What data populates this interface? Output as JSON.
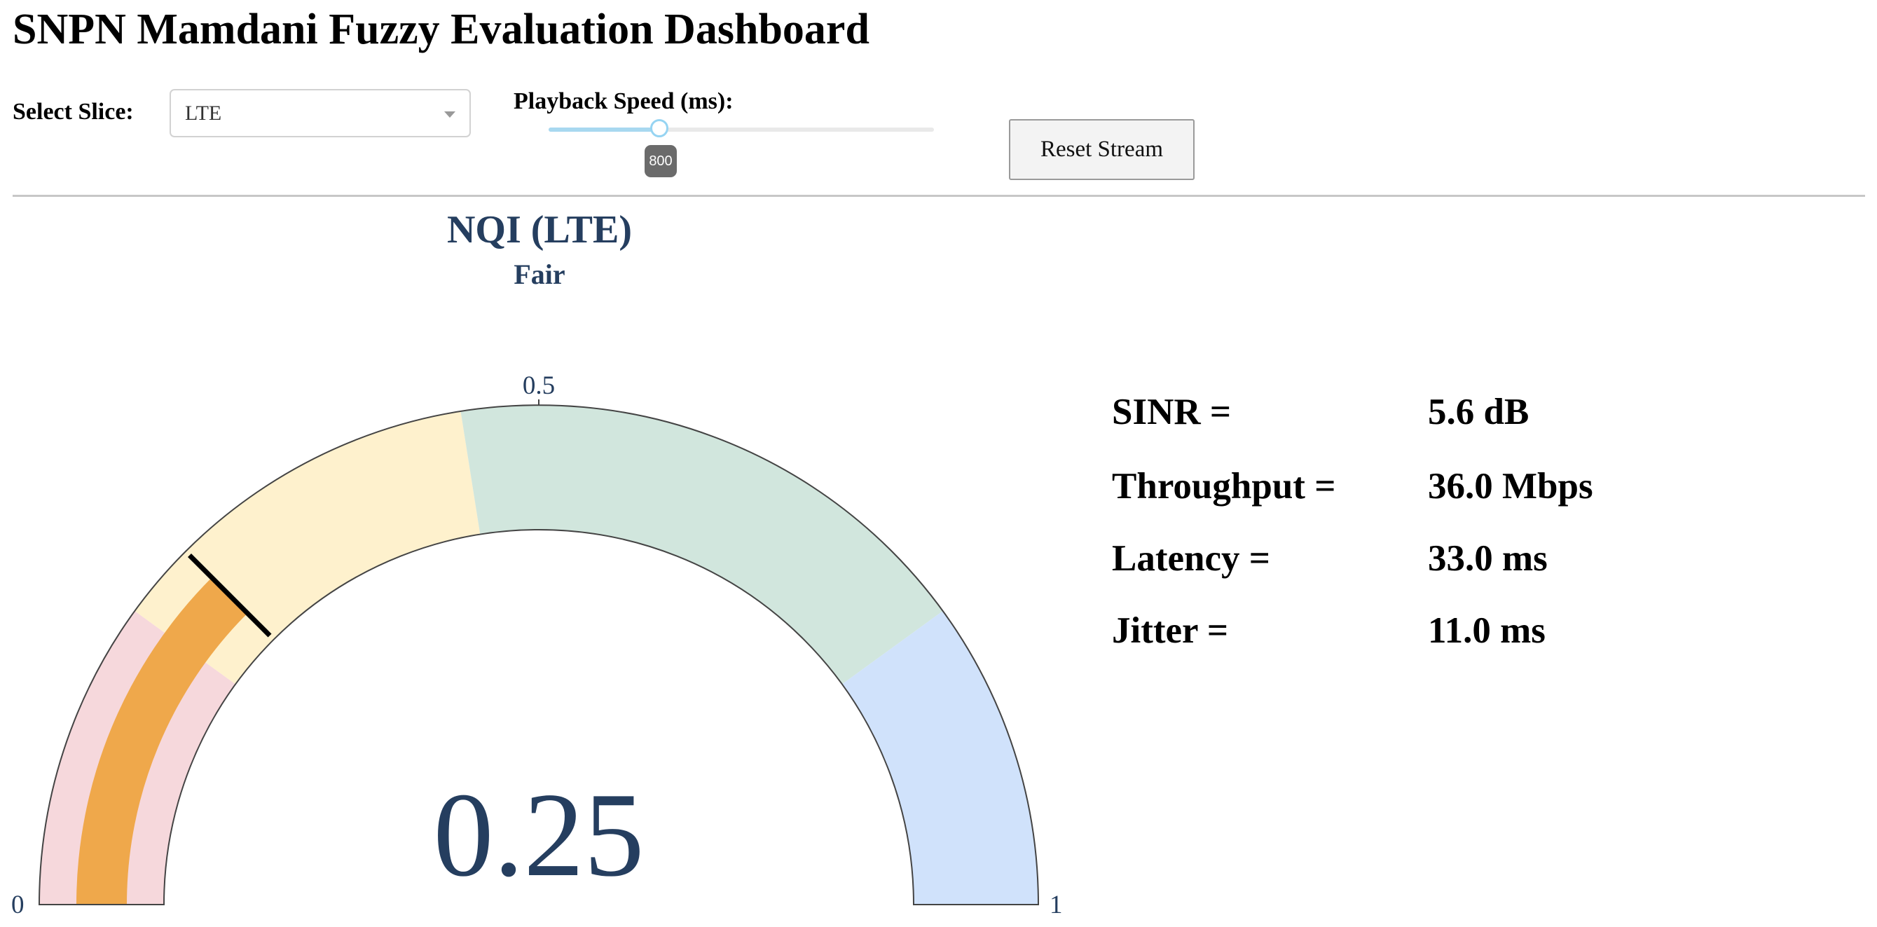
{
  "title": "SNPN Mamdani Fuzzy Evaluation Dashboard",
  "controls": {
    "slice_label": "Select Slice:",
    "slice_value": "LTE",
    "speed_label": "Playback Speed (ms):",
    "speed_value": "800",
    "reset_label": "Reset Stream"
  },
  "gauge": {
    "title": "NQI (LTE)",
    "subtitle": "Fair",
    "value": 0.25,
    "value_text": "0.25",
    "threshold": 0.25,
    "range": [
      0,
      1
    ],
    "tick_labels": [
      "0",
      "0.5",
      "1"
    ],
    "bands": [
      {
        "from": 0.0,
        "to": 0.2,
        "color": "#f6d8dc"
      },
      {
        "from": 0.2,
        "to": 0.45,
        "color": "#fef1cd"
      },
      {
        "from": 0.45,
        "to": 0.8,
        "color": "#d1e6dd"
      },
      {
        "from": 0.8,
        "to": 1.0,
        "color": "#d0e2fb"
      }
    ],
    "bar_color": "#efa84b",
    "text_color": "#253e5f"
  },
  "metrics": [
    {
      "label": "SINR =",
      "value": "5.6 dB"
    },
    {
      "label": "Throughput =",
      "value": "36.0 Mbps"
    },
    {
      "label": "Latency =",
      "value": "33.0 ms"
    },
    {
      "label": "Jitter =",
      "value": "11.0 ms"
    }
  ]
}
